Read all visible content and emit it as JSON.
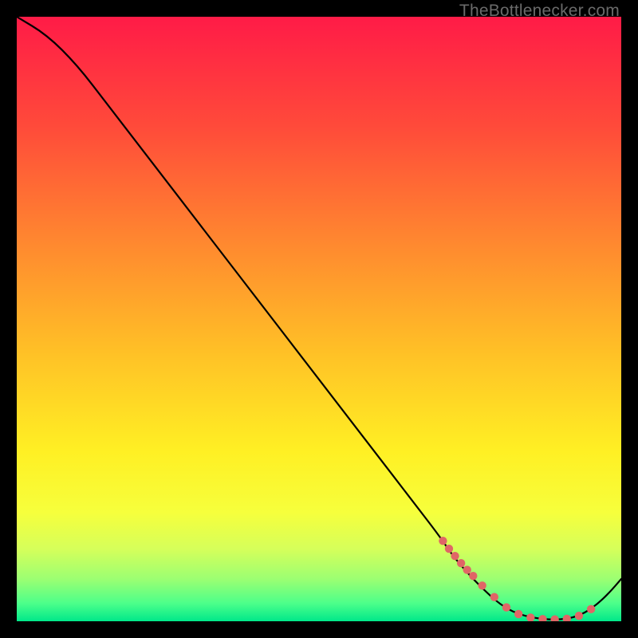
{
  "watermark": "TheBottlenecker.com",
  "chart_data": {
    "type": "line",
    "title": "",
    "xlabel": "",
    "ylabel": "",
    "xlim": [
      0,
      100
    ],
    "ylim": [
      0,
      100
    ],
    "grid": false,
    "series": [
      {
        "name": "curve",
        "x": [
          0,
          5,
          10,
          15,
          20,
          25,
          30,
          35,
          40,
          45,
          50,
          55,
          60,
          65,
          70,
          72,
          75,
          78,
          80,
          82,
          84,
          86,
          88,
          90,
          92,
          94,
          96,
          98,
          100
        ],
        "y": [
          100,
          97,
          92,
          85.5,
          79,
          72.5,
          66,
          59.5,
          53,
          46.5,
          40,
          33.5,
          27,
          20.5,
          14,
          11,
          7.5,
          4.5,
          2.8,
          1.6,
          0.9,
          0.5,
          0.3,
          0.3,
          0.6,
          1.4,
          2.8,
          4.7,
          7
        ]
      }
    ],
    "markers": {
      "name": "highlight-dots",
      "color": "#e06666",
      "x": [
        70.5,
        71.5,
        72.5,
        73.5,
        74.5,
        75.5,
        77,
        79,
        81,
        83,
        85,
        87,
        89,
        91,
        93,
        95
      ],
      "y": [
        13.3,
        12.0,
        10.8,
        9.6,
        8.5,
        7.5,
        5.9,
        4.0,
        2.3,
        1.2,
        0.6,
        0.35,
        0.3,
        0.4,
        0.9,
        2.0
      ]
    },
    "gradient": {
      "stops": [
        {
          "offset": 0.0,
          "color": "#ff1b47"
        },
        {
          "offset": 0.18,
          "color": "#ff4a3a"
        },
        {
          "offset": 0.38,
          "color": "#ff8a2f"
        },
        {
          "offset": 0.56,
          "color": "#ffc226"
        },
        {
          "offset": 0.72,
          "color": "#fff024"
        },
        {
          "offset": 0.82,
          "color": "#f6ff3c"
        },
        {
          "offset": 0.88,
          "color": "#d6ff5a"
        },
        {
          "offset": 0.93,
          "color": "#9cff72"
        },
        {
          "offset": 0.97,
          "color": "#4dff8a"
        },
        {
          "offset": 1.0,
          "color": "#00e88a"
        }
      ]
    }
  }
}
